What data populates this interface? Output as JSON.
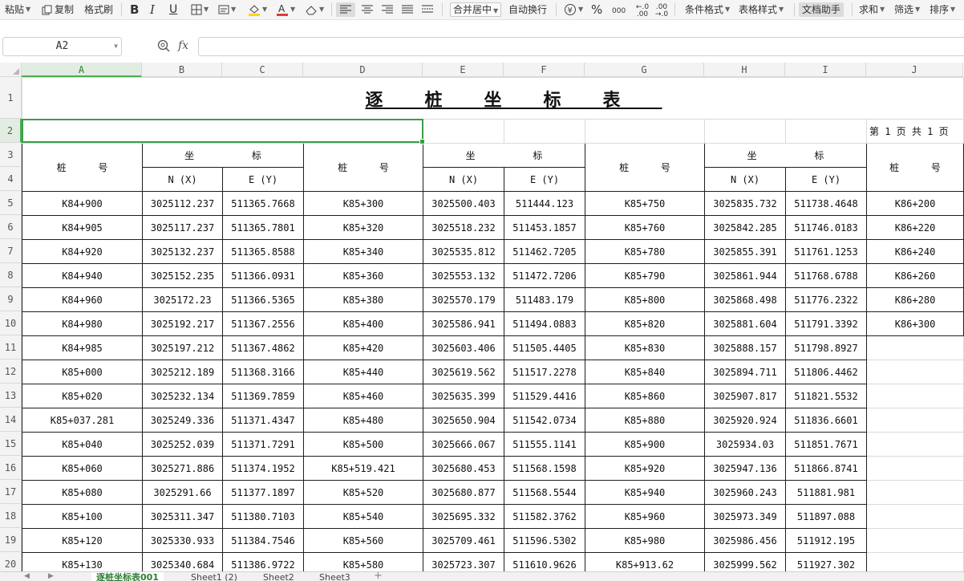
{
  "toolbar": {
    "paste": "粘贴",
    "copy": "复制",
    "format_painter": "格式刷",
    "merge_center": "合并居中",
    "wrap_text": "自动换行",
    "percent_symbol": "%",
    "thousands_symbol": "000",
    "inc_decimal_symbol": "←.0 .00",
    "dec_decimal_symbol": ".00 →.0",
    "conditional_format": "条件格式",
    "table_style": "表格样式",
    "doc_assistant": "文档助手",
    "sum": "求和",
    "filter": "筛选",
    "sort": "排序",
    "font_color": "#e53935",
    "fill_color": "#ffd600"
  },
  "formula_bar": {
    "cell_ref": "A2",
    "fx_label": "fx",
    "formula": ""
  },
  "columns": [
    "A",
    "B",
    "C",
    "D",
    "E",
    "F",
    "G",
    "H",
    "I",
    "J"
  ],
  "selected_column": "A",
  "selected_row": "2",
  "rows": [
    "1",
    "2",
    "3",
    "4",
    "5",
    "6",
    "7",
    "8",
    "9",
    "10",
    "11",
    "12",
    "13",
    "14",
    "15",
    "16",
    "17",
    "18",
    "19",
    "20"
  ],
  "sheet": {
    "title": "逐桩坐标表",
    "page_info": "第 1 页   共 1 页",
    "headers": {
      "station": "桩 号",
      "coordinate": "坐 标",
      "nx": "N (X)",
      "ey": "E (Y)"
    },
    "data": [
      [
        "K84+900",
        "3025112.237",
        "511365.7668",
        "K85+300",
        "3025500.403",
        "511444.123",
        "K85+750",
        "3025835.732",
        "511738.4648",
        "K86+200"
      ],
      [
        "K84+905",
        "3025117.237",
        "511365.7801",
        "K85+320",
        "3025518.232",
        "511453.1857",
        "K85+760",
        "3025842.285",
        "511746.0183",
        "K86+220"
      ],
      [
        "K84+920",
        "3025132.237",
        "511365.8588",
        "K85+340",
        "3025535.812",
        "511462.7205",
        "K85+780",
        "3025855.391",
        "511761.1253",
        "K86+240"
      ],
      [
        "K84+940",
        "3025152.235",
        "511366.0931",
        "K85+360",
        "3025553.132",
        "511472.7206",
        "K85+790",
        "3025861.944",
        "511768.6788",
        "K86+260"
      ],
      [
        "K84+960",
        "3025172.23",
        "511366.5365",
        "K85+380",
        "3025570.179",
        "511483.179",
        "K85+800",
        "3025868.498",
        "511776.2322",
        "K86+280"
      ],
      [
        "K84+980",
        "3025192.217",
        "511367.2556",
        "K85+400",
        "3025586.941",
        "511494.0883",
        "K85+820",
        "3025881.604",
        "511791.3392",
        "K86+300"
      ],
      [
        "K84+985",
        "3025197.212",
        "511367.4862",
        "K85+420",
        "3025603.406",
        "511505.4405",
        "K85+830",
        "3025888.157",
        "511798.8927",
        ""
      ],
      [
        "K85+000",
        "3025212.189",
        "511368.3166",
        "K85+440",
        "3025619.562",
        "511517.2278",
        "K85+840",
        "3025894.711",
        "511806.4462",
        ""
      ],
      [
        "K85+020",
        "3025232.134",
        "511369.7859",
        "K85+460",
        "3025635.399",
        "511529.4416",
        "K85+860",
        "3025907.817",
        "511821.5532",
        ""
      ],
      [
        "K85+037.281",
        "3025249.336",
        "511371.4347",
        "K85+480",
        "3025650.904",
        "511542.0734",
        "K85+880",
        "3025920.924",
        "511836.6601",
        ""
      ],
      [
        "K85+040",
        "3025252.039",
        "511371.7291",
        "K85+500",
        "3025666.067",
        "511555.1141",
        "K85+900",
        "3025934.03",
        "511851.7671",
        ""
      ],
      [
        "K85+060",
        "3025271.886",
        "511374.1952",
        "K85+519.421",
        "3025680.453",
        "511568.1598",
        "K85+920",
        "3025947.136",
        "511866.8741",
        ""
      ],
      [
        "K85+080",
        "3025291.66",
        "511377.1897",
        "K85+520",
        "3025680.877",
        "511568.5544",
        "K85+940",
        "3025960.243",
        "511881.981",
        ""
      ],
      [
        "K85+100",
        "3025311.347",
        "511380.7103",
        "K85+540",
        "3025695.332",
        "511582.3762",
        "K85+960",
        "3025973.349",
        "511897.088",
        ""
      ],
      [
        "K85+120",
        "3025330.933",
        "511384.7546",
        "K85+560",
        "3025709.461",
        "511596.5302",
        "K85+980",
        "3025986.456",
        "511912.195",
        ""
      ],
      [
        "K85+130",
        "3025340.684",
        "511386.9722",
        "K85+580",
        "3025723.307",
        "511610.9626",
        "K85+913.62",
        "3025999.562",
        "511927.302",
        ""
      ]
    ]
  },
  "tabs": [
    {
      "label": "逐桩坐标表001",
      "active": true
    },
    {
      "label": "Sheet1 (2)",
      "active": false
    },
    {
      "label": "Sheet2",
      "active": false
    },
    {
      "label": "Sheet3",
      "active": false
    }
  ]
}
